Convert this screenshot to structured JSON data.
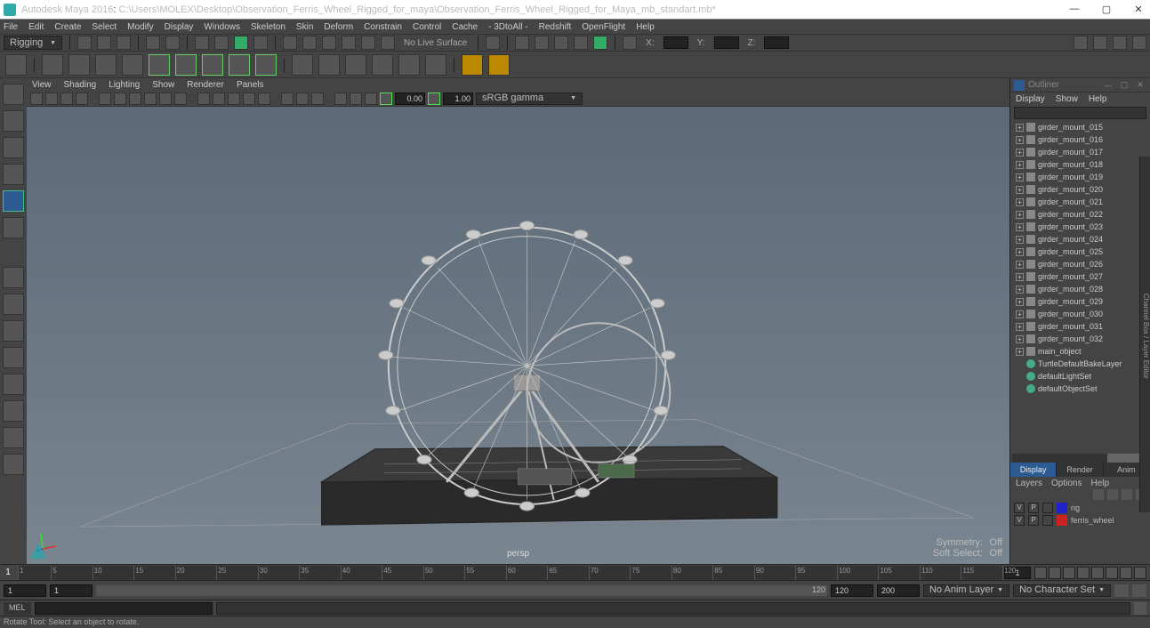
{
  "titlebar": {
    "app": "Autodesk Maya 2016",
    "path": "C:\\Users\\MOLEX\\Desktop\\Observation_Ferris_Wheel_Rigged_for_maya\\Observation_Ferris_Wheel_Rigged_for_Maya_mb_standart.mb*"
  },
  "menus": [
    "File",
    "Edit",
    "Create",
    "Select",
    "Modify",
    "Display",
    "Windows",
    "Skeleton",
    "Skin",
    "Deform",
    "Constrain",
    "Control",
    "Cache",
    "- 3DtoAll -",
    "Redshift",
    "OpenFlight",
    "Help"
  ],
  "mode": {
    "selected": "Rigging",
    "status_label": "No Live Surface",
    "axes": [
      "X:",
      "Y:",
      "Z:"
    ]
  },
  "viewmenus": [
    "View",
    "Shading",
    "Lighting",
    "Show",
    "Renderer",
    "Panels"
  ],
  "viewtool": {
    "num1": "0.00",
    "num2": "1.00",
    "colorspace": "sRGB gamma"
  },
  "viewport": {
    "camera": "persp",
    "symmetry_label": "Symmetry:",
    "symmetry_val": "Off",
    "softsel_label": "Soft Select:",
    "softsel_val": "Off"
  },
  "outliner": {
    "title": "Outliner",
    "menus": [
      "Display",
      "Show",
      "Help"
    ],
    "items": [
      {
        "name": "girder_mount_015",
        "type": "transform",
        "expandable": true
      },
      {
        "name": "girder_mount_016",
        "type": "transform",
        "expandable": true
      },
      {
        "name": "girder_mount_017",
        "type": "transform",
        "expandable": true
      },
      {
        "name": "girder_mount_018",
        "type": "transform",
        "expandable": true
      },
      {
        "name": "girder_mount_019",
        "type": "transform",
        "expandable": true
      },
      {
        "name": "girder_mount_020",
        "type": "transform",
        "expandable": true
      },
      {
        "name": "girder_mount_021",
        "type": "transform",
        "expandable": true
      },
      {
        "name": "girder_mount_022",
        "type": "transform",
        "expandable": true
      },
      {
        "name": "girder_mount_023",
        "type": "transform",
        "expandable": true
      },
      {
        "name": "girder_mount_024",
        "type": "transform",
        "expandable": true
      },
      {
        "name": "girder_mount_025",
        "type": "transform",
        "expandable": true
      },
      {
        "name": "girder_mount_026",
        "type": "transform",
        "expandable": true
      },
      {
        "name": "girder_mount_027",
        "type": "transform",
        "expandable": true
      },
      {
        "name": "girder_mount_028",
        "type": "transform",
        "expandable": true
      },
      {
        "name": "girder_mount_029",
        "type": "transform",
        "expandable": true
      },
      {
        "name": "girder_mount_030",
        "type": "transform",
        "expandable": true
      },
      {
        "name": "girder_mount_031",
        "type": "transform",
        "expandable": true
      },
      {
        "name": "girder_mount_032",
        "type": "transform",
        "expandable": true
      },
      {
        "name": "main_object",
        "type": "transform",
        "expandable": true
      },
      {
        "name": "TurtleDefaultBakeLayer",
        "type": "set",
        "expandable": false
      },
      {
        "name": "defaultLightSet",
        "type": "set",
        "expandable": false
      },
      {
        "name": "defaultObjectSet",
        "type": "set",
        "expandable": false
      }
    ]
  },
  "channelbox": {
    "tabs": [
      "Display",
      "Render",
      "Anim"
    ],
    "active_tab": 0,
    "menus": [
      "Layers",
      "Options",
      "Help"
    ],
    "layers": [
      {
        "v": "V",
        "p": "P",
        "color": "#2222cc",
        "name": "rig"
      },
      {
        "v": "V",
        "p": "P",
        "color": "#cc2222",
        "name": "ferris_wheel"
      }
    ]
  },
  "timeline": {
    "current": "1",
    "ticks": [
      1,
      5,
      10,
      15,
      20,
      25,
      30,
      35,
      40,
      45,
      50,
      55,
      60,
      65,
      70,
      75,
      80,
      85,
      90,
      95,
      100,
      105,
      110,
      115,
      120
    ],
    "range_start_cur": "1",
    "playback": {
      "start_outer": "1",
      "start_inner": "1",
      "end_inner": "120",
      "end_outer": "120",
      "max": "200"
    },
    "anim_layer": "No Anim Layer",
    "char_set": "No Character Set"
  },
  "cmd": {
    "lang": "MEL"
  },
  "help": "Rotate Tool: Select an object to rotate.",
  "sidetab": "Channel Box / Layer Editor"
}
